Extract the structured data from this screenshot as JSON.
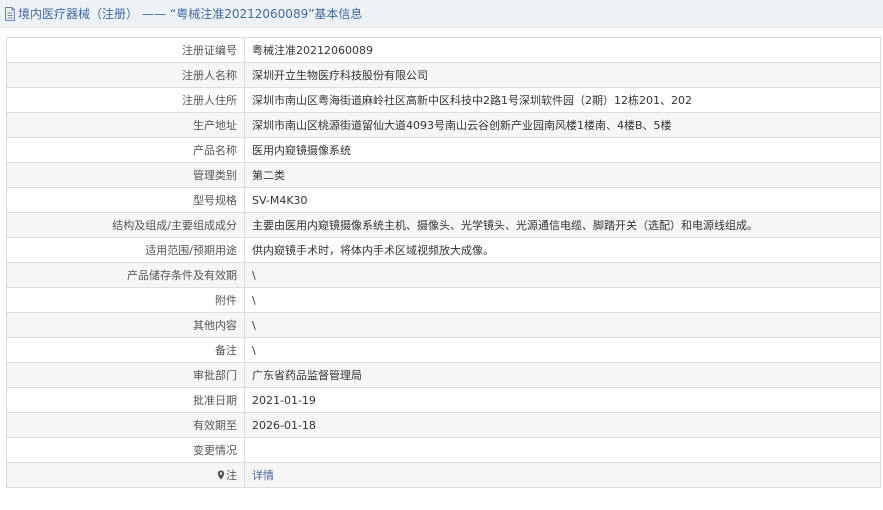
{
  "header": {
    "category": "境内医疗器械（注册）",
    "separator": "——",
    "title": "“粤械注准20212060089”基本信息"
  },
  "rows": [
    {
      "label": "注册证编号",
      "value": "粤械注准20212060089"
    },
    {
      "label": "注册人名称",
      "value": "深圳开立生物医疗科技股份有限公司"
    },
    {
      "label": "注册人住所",
      "value": "深圳市南山区粤海街道麻岭社区高新中区科技中2路1号深圳软件园（2期）12栋201、202"
    },
    {
      "label": "生产地址",
      "value": "深圳市南山区桃源街道留仙大道4093号南山云谷创新产业园南风楼1楼南、4楼B、5楼"
    },
    {
      "label": "产品名称",
      "value": "医用内窥镜摄像系统"
    },
    {
      "label": "管理类别",
      "value": "第二类"
    },
    {
      "label": "型号规格",
      "value": "SV-M4K30"
    },
    {
      "label": "结构及组成/主要组成成分",
      "value": "主要由医用内窥镜摄像系统主机、摄像头、光学镜头、光源通信电缆、脚踏开关（选配）和电源线组成。"
    },
    {
      "label": "适用范围/预期用途",
      "value": "供内窥镜手术时，将体内手术区域视频放大成像。"
    },
    {
      "label": "产品储存条件及有效期",
      "value": "\\"
    },
    {
      "label": "附件",
      "value": "\\"
    },
    {
      "label": "其他内容",
      "value": "\\"
    },
    {
      "label": "备注",
      "value": "\\"
    },
    {
      "label": "审批部门",
      "value": "广东省药品监督管理局"
    },
    {
      "label": "批准日期",
      "value": "2021-01-19"
    },
    {
      "label": "有效期至",
      "value": "2026-01-18"
    },
    {
      "label": "变更情况",
      "value": ""
    }
  ],
  "note_row": {
    "label": "注",
    "link_text": "详情",
    "icon": "pin-icon"
  },
  "colors": {
    "link": "#3f6aa5",
    "header_bg": "#eef1f4",
    "border": "#dcdcdc"
  }
}
